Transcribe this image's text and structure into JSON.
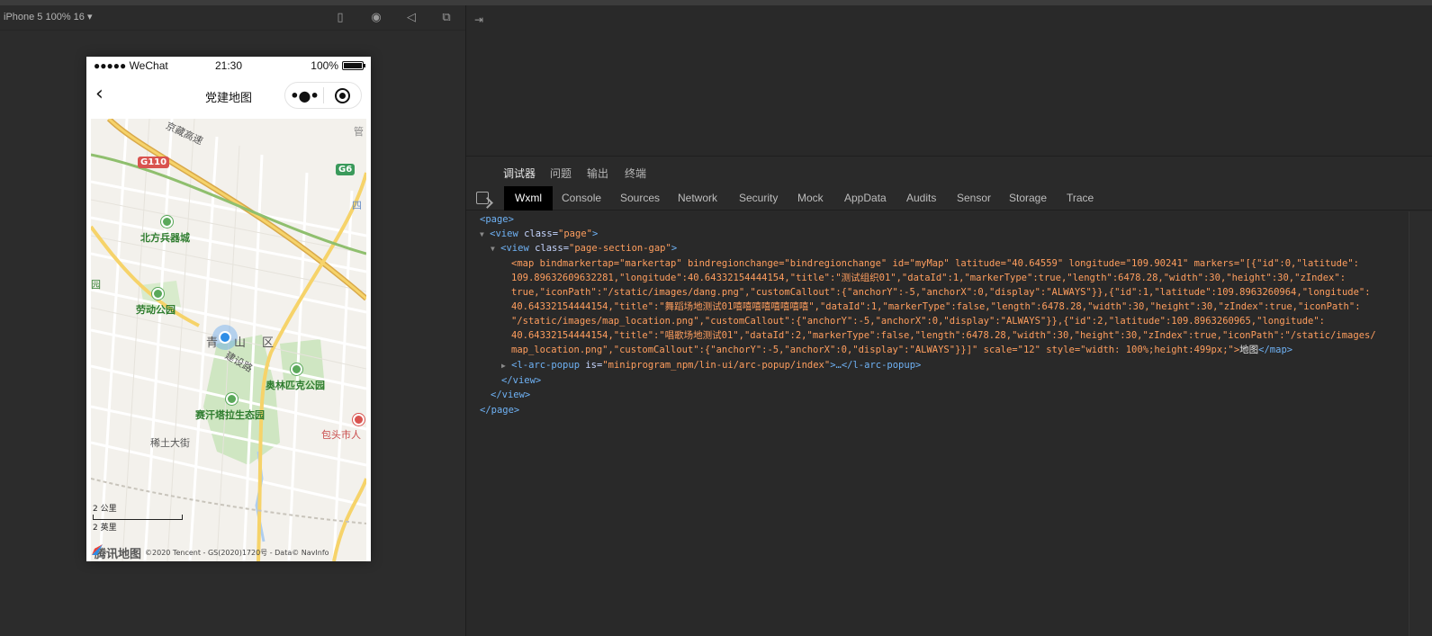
{
  "simulator": {
    "device_label": "iPhone 5 100% 16 ▾",
    "status": {
      "signal": "●●●●● WeChat",
      "time": "21:30",
      "battery": "100%"
    },
    "nav_title": "党建地图",
    "map": {
      "labels": {
        "jingzang": "京藏高速",
        "g110": "G110",
        "g6": "G6",
        "guan": "管",
        "si": "四",
        "beifang": "北方兵器城",
        "yuan": "园",
        "laodong": "劳动公园",
        "qingshan": "青山区",
        "jianshe": "建设路",
        "aolinpike": "奥林匹克公园",
        "saihan": "赛汗塔拉生态园",
        "xitu": "稀土大街",
        "baotou": "包头市人"
      },
      "scale_km": "2 公里",
      "scale_mi": "2 英里",
      "logo": "腾讯地图",
      "copyright": "©2020 Tencent - GS(2020)1720号 - Data© NavInfo"
    },
    "colors": {
      "park": "#cfe6c2",
      "highway": "#f4c84a",
      "road": "#ffffff",
      "water": "#aecdee"
    }
  },
  "devtools": {
    "panel_tabs": [
      "调试器",
      "问题",
      "输出",
      "终端"
    ],
    "sub_tabs": [
      "Wxml",
      "Console",
      "Sources",
      "Network",
      "Security",
      "Mock",
      "AppData",
      "Audits",
      "Sensor",
      "Storage",
      "Trace"
    ],
    "wxml": {
      "l1": "<page>",
      "l2_tag": "<view",
      "l2_attr": " class=",
      "l2_val": "\"page\"",
      "l2_end": ">",
      "l3_tag": "<view",
      "l3_attr": " class=",
      "l3_val": "\"page-section-gap\"",
      "l3_end": ">",
      "map_line1": "<map bindmarkertap=\"markertap\" bindregionchange=\"bindregionchange\" id=\"myMap\" latitude=\"40.64559\" longitude=\"109.90241\" markers=\"[{\"id\":0,\"latitude\":",
      "map_line2": "109.89632609632281,\"longitude\":40.64332154444154,\"title\":\"测试组织01\",\"dataId\":1,\"markerType\":true,\"length\":6478.28,\"width\":30,\"height\":30,\"zIndex\":",
      "map_line3": "true,\"iconPath\":\"/static/images/dang.png\",\"customCallout\":{\"anchorY\":-5,\"anchorX\":0,\"display\":\"ALWAYS\"}},{\"id\":1,\"latitude\":109.8963260964,\"longitude\":",
      "map_line4": "40.64332154444154,\"title\":\"舞蹈场地测试01嘻嘻嘻嘻嘻嘻嘻嘻\",\"dataId\":1,\"markerType\":false,\"length\":6478.28,\"width\":30,\"height\":30,\"zIndex\":true,\"iconPath\":",
      "map_line5": "\"/static/images/map_location.png\",\"customCallout\":{\"anchorY\":-5,\"anchorX\":0,\"display\":\"ALWAYS\"}},{\"id\":2,\"latitude\":109.8963260965,\"longitude\":",
      "map_line6": "40.64332154444154,\"title\":\"唱歌场地测试01\",\"dataId\":2,\"markerType\":false,\"length\":6478.28,\"width\":30,\"height\":30,\"zIndex\":true,\"iconPath\":\"/static/images/",
      "map_line7a": "map_location.png\",\"customCallout\":{\"anchorY\":-5,\"anchorX\":0,\"display\":\"ALWAYS\"}}]\" scale=\"12\" style=\"width: 100%;height:499px;\">",
      "map_line7_text": "地图",
      "map_line7_close": "</map>",
      "popup_tag": "<l-arc-popup",
      "popup_attr": " is=",
      "popup_val": "\"miniprogram_npm/lin-ui/arc-popup/index\"",
      "popup_end": ">…</l-arc-popup>",
      "close_view1": "</view>",
      "close_view2": "</view>",
      "close_page": "</page>"
    }
  }
}
